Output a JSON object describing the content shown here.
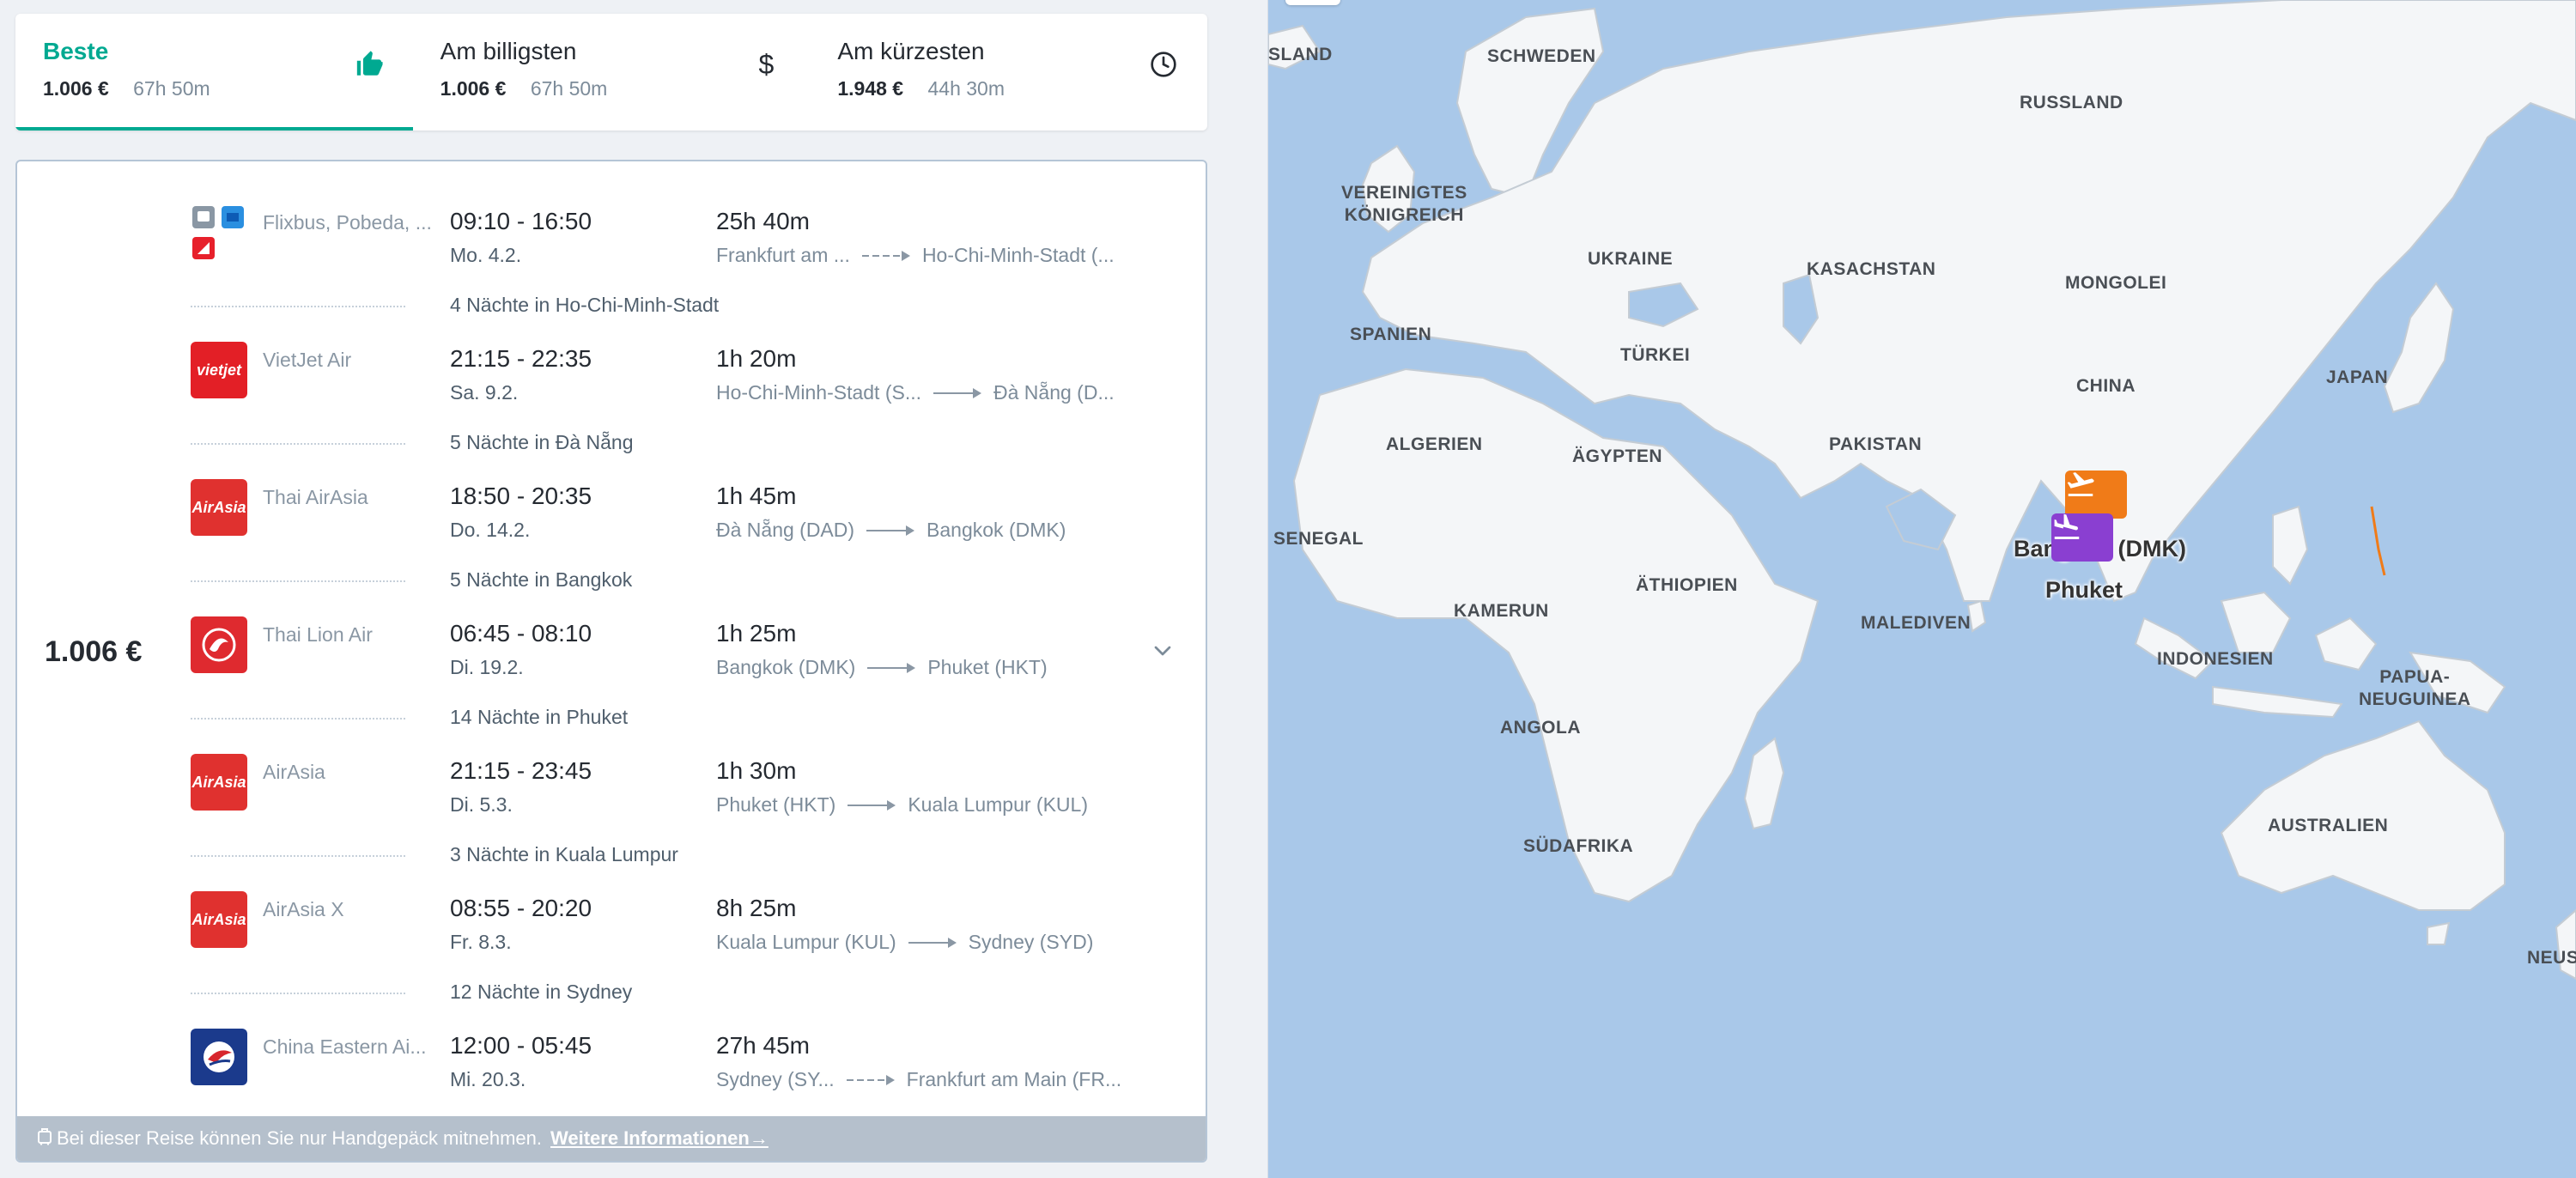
{
  "sort_tabs": [
    {
      "title": "Beste",
      "price": "1.006 €",
      "duration": "67h 50m",
      "icon": "thumbs-up-icon",
      "active": true
    },
    {
      "title": "Am billigsten",
      "price": "1.006 €",
      "duration": "67h 50m",
      "icon": "dollar-icon",
      "active": false
    },
    {
      "title": "Am kürzesten",
      "price": "1.948 €",
      "duration": "44h 30m",
      "icon": "clock-icon",
      "active": false
    }
  ],
  "result": {
    "price": "1.006 €",
    "segments": [
      {
        "carrier": "Flixbus, Pobeda, ...",
        "times": "09:10 - 16:50",
        "date": "Mo. 4.2.",
        "duration": "25h 40m",
        "from": "Frankfurt am ...",
        "to": "Ho-Chi-Minh-Stadt (...",
        "has_stops": true,
        "logo": "multi-carrier-logos",
        "logo_color": "#e7202b"
      },
      {
        "carrier": "VietJet Air",
        "times": "21:15 - 22:35",
        "date": "Sa. 9.2.",
        "duration": "1h 20m",
        "from": "Ho-Chi-Minh-Stadt (S...",
        "to": "Đà Nẵng (D...",
        "has_stops": false,
        "logo": "vietjet-logo",
        "logo_text": "vietjet",
        "logo_color": "#e31f26"
      },
      {
        "carrier": "Thai AirAsia",
        "times": "18:50 - 20:35",
        "date": "Do. 14.2.",
        "duration": "1h 45m",
        "from": "Đà Nẵng (DAD)",
        "to": "Bangkok (DMK)",
        "has_stops": false,
        "logo": "airasia-logo",
        "logo_text": "AirAsia",
        "logo_color": "#e0312f"
      },
      {
        "carrier": "Thai Lion Air",
        "times": "06:45 - 08:10",
        "date": "Di. 19.2.",
        "duration": "1h 25m",
        "from": "Bangkok (DMK)",
        "to": "Phuket (HKT)",
        "has_stops": false,
        "logo": "lion-air-logo",
        "logo_color": "#df2a2f"
      },
      {
        "carrier": "AirAsia",
        "times": "21:15 - 23:45",
        "date": "Di. 5.3.",
        "duration": "1h 30m",
        "from": "Phuket (HKT)",
        "to": "Kuala Lumpur (KUL)",
        "has_stops": false,
        "logo": "airasia-logo",
        "logo_text": "AirAsia",
        "logo_color": "#e0312f"
      },
      {
        "carrier": "AirAsia X",
        "times": "08:55 - 20:20",
        "date": "Fr. 8.3.",
        "duration": "8h 25m",
        "from": "Kuala Lumpur (KUL)",
        "to": "Sydney (SYD)",
        "has_stops": false,
        "logo": "airasia-logo",
        "logo_text": "AirAsia",
        "logo_color": "#e0312f"
      },
      {
        "carrier": "China Eastern Ai...",
        "times": "12:00 - 05:45",
        "date": "Mi. 20.3.",
        "duration": "27h 45m",
        "from": "Sydney (SY...",
        "to": "Frankfurt am Main (FR...",
        "has_stops": true,
        "logo": "china-eastern-logo",
        "logo_color": "#1b3a8c"
      }
    ],
    "stays": [
      "4 Nächte in Ho-Chi-Minh-Stadt",
      "5 Nächte in Đà Nẵng",
      "5 Nächte in Bangkok",
      "14 Nächte in Phuket",
      "3 Nächte in Kuala Lumpur",
      "12 Nächte in Sydney"
    ],
    "notice_text": "Bei dieser Reise können Sie nur Handgepäck mitnehmen.",
    "notice_link": "Weitere Informationen→"
  },
  "map": {
    "country_labels": [
      {
        "id": "island",
        "text": "SLAND"
      },
      {
        "id": "schweden",
        "text": "SCHWEDEN"
      },
      {
        "id": "russland",
        "text": "RUSSLAND"
      },
      {
        "id": "uk",
        "text": "VEREINIGTES\nKÖNIGREICH"
      },
      {
        "id": "ukraine",
        "text": "UKRAINE"
      },
      {
        "id": "kasachstan",
        "text": "KASACHSTAN"
      },
      {
        "id": "mongolei",
        "text": "MONGOLEI"
      },
      {
        "id": "spanien",
        "text": "SPANIEN"
      },
      {
        "id": "tuerkei",
        "text": "TÜRKEI"
      },
      {
        "id": "china",
        "text": "CHINA"
      },
      {
        "id": "japan",
        "text": "JAPAN"
      },
      {
        "id": "algerien",
        "text": "ALGERIEN"
      },
      {
        "id": "aegypten",
        "text": "ÄGYPTEN"
      },
      {
        "id": "pakistan",
        "text": "PAKISTAN"
      },
      {
        "id": "senegal",
        "text": "SENEGAL"
      },
      {
        "id": "aethiopien",
        "text": "ÄTHIOPIEN"
      },
      {
        "id": "kamerun",
        "text": "KAMERUN"
      },
      {
        "id": "malediven",
        "text": "MALEDIVEN"
      },
      {
        "id": "indonesien",
        "text": "INDONESIEN"
      },
      {
        "id": "papua",
        "text": "PAPUA-\nNEUGUINEA"
      },
      {
        "id": "angola",
        "text": "ANGOLA"
      },
      {
        "id": "suedafrika",
        "text": "SÜDAFRIKA"
      },
      {
        "id": "australien",
        "text": "AUSTRALIEN"
      },
      {
        "id": "neuseeland",
        "text": "NEUSE"
      }
    ],
    "city_bangkok": "Bangkok (DMK)",
    "city_phuket": "Phuket",
    "pin_departure_icon": "airplane-takeoff-icon",
    "pin_arrival_icon": "airplane-landing-icon",
    "colors": {
      "water": "#a9c8e9",
      "land": "#f4f6f8",
      "accent": "#00a991",
      "pin_orange": "#f07b18",
      "pin_purple": "#8a3fd1"
    }
  }
}
